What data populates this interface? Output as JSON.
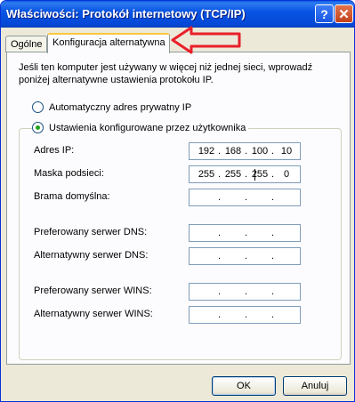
{
  "window": {
    "title": "Właściwości: Protokół internetowy (TCP/IP)",
    "help_label": "?",
    "close_label": "✕"
  },
  "tabs": [
    {
      "label": "Ogólne",
      "selected": false
    },
    {
      "label": "Konfiguracja alternatywna",
      "selected": true
    }
  ],
  "description": "Jeśli ten komputer jest używany w więcej niż jednej sieci, wprowadź poniżej alternatywne ustawienia protokołu IP.",
  "radios": {
    "auto": {
      "label": "Automatyczny adres prywatny IP",
      "checked": false
    },
    "user": {
      "label": "Ustawienia konfigurowane przez użytkownika",
      "checked": true
    }
  },
  "fields": {
    "ip": {
      "label": "Adres IP:",
      "octets": [
        "192",
        "168",
        "100",
        "10"
      ]
    },
    "mask": {
      "label": "Maska podsieci:",
      "octets": [
        "255",
        "255",
        "255",
        "0"
      ]
    },
    "gateway": {
      "label": "Brama domyślna:",
      "octets": [
        "",
        "",
        "",
        ""
      ]
    },
    "dns1": {
      "label": "Preferowany serwer DNS:",
      "octets": [
        "",
        "",
        "",
        ""
      ]
    },
    "dns2": {
      "label": "Alternatywny serwer DNS:",
      "octets": [
        "",
        "",
        "",
        ""
      ]
    },
    "wins1": {
      "label": "Preferowany serwer WINS:",
      "octets": [
        "",
        "",
        "",
        ""
      ]
    },
    "wins2": {
      "label": "Alternatywny serwer WINS:",
      "octets": [
        "",
        "",
        "",
        ""
      ]
    }
  },
  "ip_dot": ".",
  "buttons": {
    "ok": "OK",
    "cancel": "Anuluj"
  },
  "colors": {
    "title_bar": "#0854e3",
    "annotation_arrow": "#e8202a",
    "radio_dot": "#21a121",
    "tab_highlight": "#ffc83c"
  }
}
